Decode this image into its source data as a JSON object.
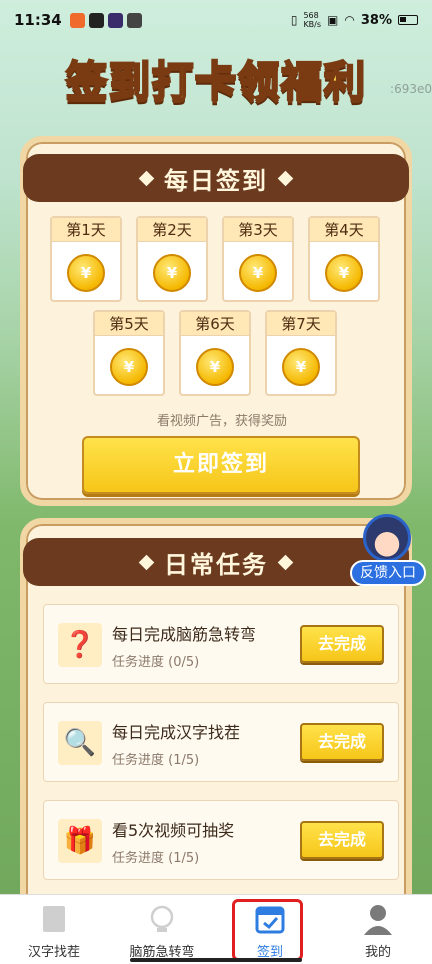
{
  "status_bar": {
    "time": "11:34",
    "net_speed_value": "568",
    "net_speed_unit": "KB/s",
    "battery": "38%"
  },
  "title": "签到打卡领福利",
  "ghost_id": ":693e0",
  "checkin": {
    "header": "每日签到",
    "coin_symbol": "¥",
    "days": [
      "第1天",
      "第2天",
      "第3天",
      "第4天",
      "第5天",
      "第6天",
      "第7天"
    ],
    "hint": "看视频广告，获得奖励",
    "button": "立即签到"
  },
  "feedback": {
    "label": "反馈入口"
  },
  "tasks": {
    "header": "日常任务",
    "items": [
      {
        "title": "每日完成脑筋急转弯",
        "progress": "任务进度 (0/5)",
        "button": "去完成",
        "icon": "question-box-icon"
      },
      {
        "title": "每日完成汉字找茬",
        "progress": "任务进度 (1/5)",
        "button": "去完成",
        "icon": "magnifier-icon"
      },
      {
        "title": "看5次视频可抽奖",
        "progress": "任务进度 (1/5)",
        "button": "去完成",
        "icon": "gift-icon"
      }
    ]
  },
  "nav": {
    "items": [
      {
        "label": "汉字找茬",
        "icon": "hanzi-icon"
      },
      {
        "label": "脑筋急转弯",
        "icon": "bulb-icon"
      },
      {
        "label": "签到",
        "icon": "calendar-check-icon",
        "active": true
      },
      {
        "label": "我的",
        "icon": "user-icon"
      }
    ]
  },
  "colors": {
    "panel_header": "#6b3a1f",
    "button_yellow": "#f6c619",
    "nav_active": "#2f7de1",
    "highlight_red": "#e02020"
  }
}
